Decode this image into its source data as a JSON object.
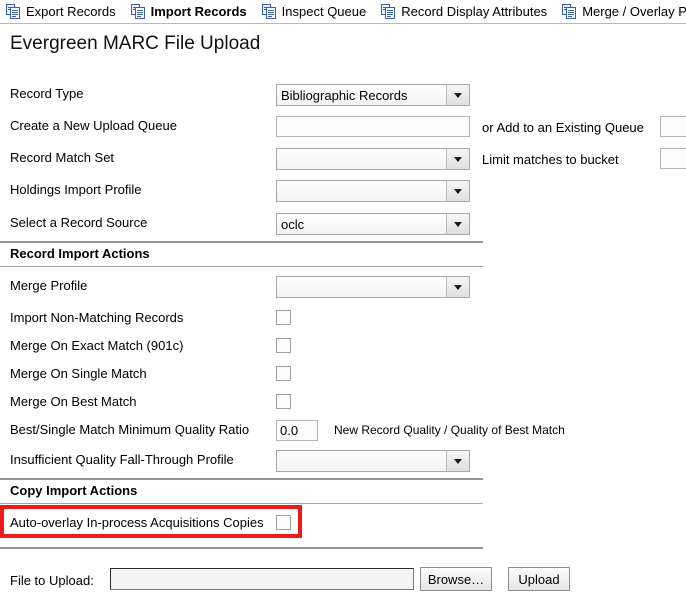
{
  "tabs": [
    {
      "label": "Export Records",
      "icon": "documents-icon",
      "active": false
    },
    {
      "label": "Import Records",
      "icon": "documents-icon",
      "active": true
    },
    {
      "label": "Inspect Queue",
      "icon": "documents-icon",
      "active": false
    },
    {
      "label": "Record Display Attributes",
      "icon": "documents-icon",
      "active": false
    },
    {
      "label": "Merge / Overlay Profile",
      "icon": "documents-icon",
      "active": false
    }
  ],
  "page": {
    "title": "Evergreen MARC File Upload"
  },
  "form": {
    "record_type": {
      "label": "Record Type",
      "value": "Bibliographic Records"
    },
    "create_queue": {
      "label": "Create a New Upload Queue",
      "value": "",
      "placeholder": ""
    },
    "existing_queue": {
      "label": "or Add to an Existing Queue",
      "value": ""
    },
    "record_match_set": {
      "label": "Record Match Set",
      "value": ""
    },
    "limit_bucket": {
      "label": "Limit matches to bucket",
      "value": ""
    },
    "holdings_profile": {
      "label": "Holdings Import Profile",
      "value": ""
    },
    "record_source": {
      "label": "Select a Record Source",
      "value": "oclc"
    }
  },
  "record_import_actions": {
    "section_title": "Record Import Actions",
    "merge_profile": {
      "label": "Merge Profile",
      "value": ""
    },
    "checkboxes": [
      {
        "label": "Import Non-Matching Records",
        "checked": false
      },
      {
        "label": "Merge On Exact Match (901c)",
        "checked": false
      },
      {
        "label": "Merge On Single Match",
        "checked": false
      },
      {
        "label": "Merge On Best Match",
        "checked": false
      }
    ],
    "quality_ratio": {
      "label": "Best/Single Match Minimum Quality Ratio",
      "value": "0.0",
      "hint": "New Record Quality / Quality of Best Match"
    },
    "fallthrough_profile": {
      "label": "Insufficient Quality Fall-Through Profile",
      "value": ""
    }
  },
  "copy_import_actions": {
    "section_title": "Copy Import Actions",
    "auto_overlay": {
      "label": "Auto-overlay In-process Acquisitions Copies",
      "checked": false
    },
    "highlight_color": "#ee1b1b"
  },
  "upload": {
    "file_label": "File to Upload:",
    "file_value": "",
    "browse_label": "Browse…",
    "upload_label": "Upload"
  }
}
